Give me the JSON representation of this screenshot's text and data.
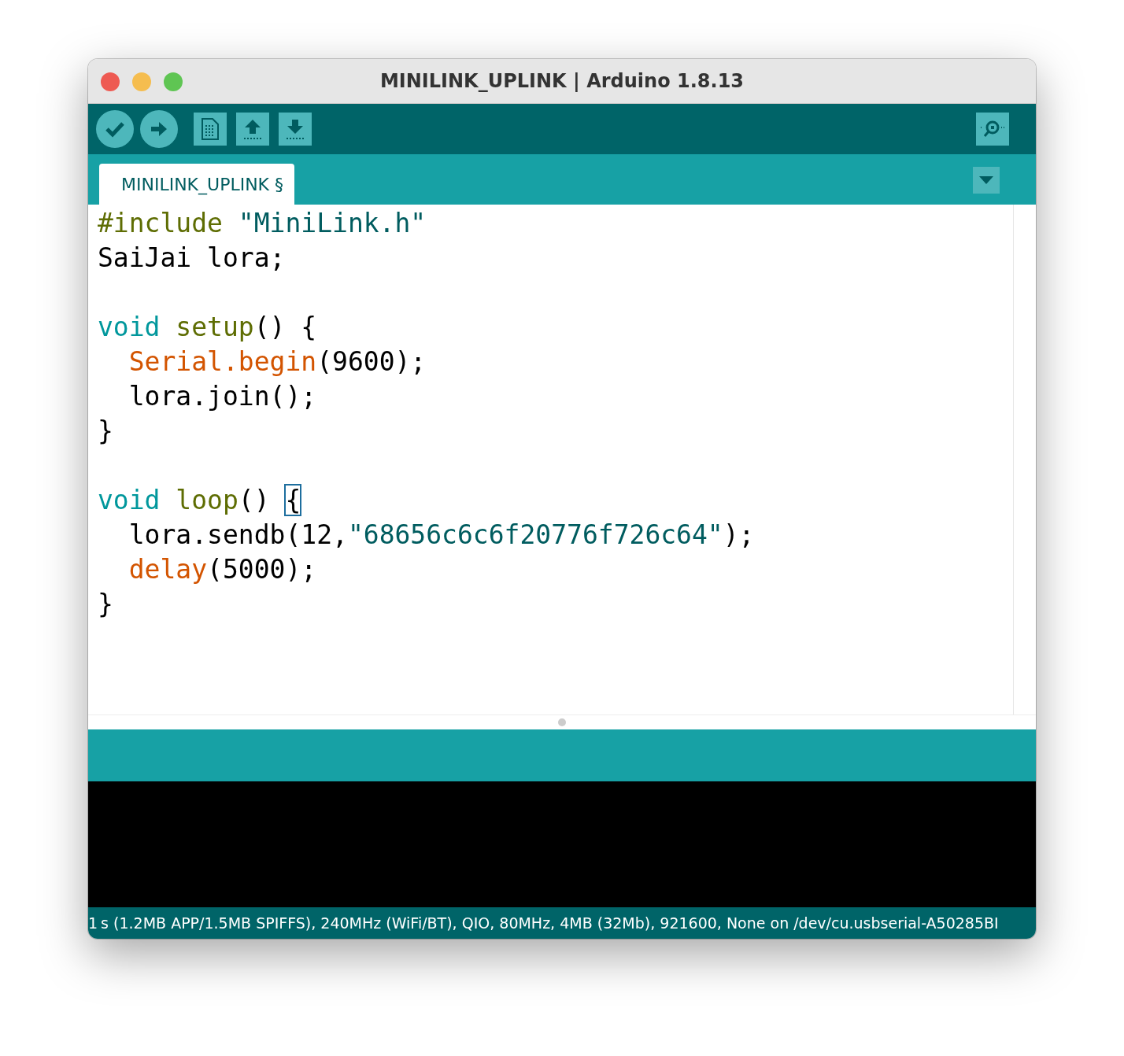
{
  "window": {
    "title": "MINILINK_UPLINK | Arduino 1.8.13"
  },
  "toolbar": {
    "buttons": [
      {
        "kind": "round"
      },
      {
        "kind": "round"
      },
      {
        "kind": "square"
      },
      {
        "kind": "square"
      },
      {
        "kind": "square"
      }
    ]
  },
  "tabs": [
    {
      "label": "MINILINK_UPLINK §",
      "selected": true
    }
  ],
  "editor": {
    "blocks": [
      [
        [
          {
            "kind": "keyword2",
            "text": "#include "
          },
          {
            "kind": "string",
            "text": "\"MiniLink.h\""
          }
        ],
        [
          {
            "kind": "plain",
            "text": "SaiJai lora;"
          }
        ]
      ],
      [
        [
          {
            "kind": "type",
            "text": "void "
          },
          {
            "kind": "keyword2",
            "text": "setup"
          },
          {
            "kind": "plain",
            "text": "() {"
          }
        ],
        [
          {
            "kind": "function",
            "text": "  Serial."
          },
          {
            "kind": "function",
            "text": "begin"
          },
          {
            "kind": "plain",
            "text": "(9600);"
          }
        ],
        [
          {
            "kind": "plain",
            "text": "  lora.join();"
          }
        ],
        [
          {
            "kind": "plain",
            "text": "}"
          }
        ]
      ],
      [
        [
          {
            "kind": "type",
            "text": "void "
          },
          {
            "kind": "keyword2",
            "text": "loop"
          },
          {
            "kind": "plain",
            "text": "() "
          },
          {
            "kind": "bracket",
            "text": "{"
          }
        ],
        [
          {
            "kind": "plain",
            "text": "  lora.sendb(12,"
          },
          {
            "kind": "string",
            "text": "\"68656c6c6f20776f726c64\""
          },
          {
            "kind": "plain",
            "text": ");"
          }
        ],
        [
          {
            "kind": "function",
            "text": "  delay"
          },
          {
            "kind": "plain",
            "text": "(5000);"
          }
        ],
        [
          {
            "kind": "plain",
            "text": "}"
          }
        ]
      ]
    ]
  },
  "status_bar": {
    "line_number": "1",
    "board": "s (1.2MB APP/1.5MB SPIFFS), 240MHz (WiFi/BT), QIO, 80MHz, 4MB (32Mb), 921600, None on /dev/cu.usbserial-A50285BI"
  }
}
